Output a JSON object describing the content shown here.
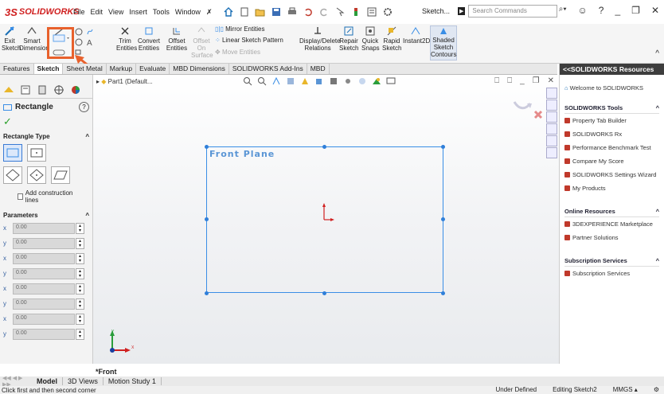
{
  "app": {
    "logo_text": "SOLIDWORKS",
    "logo_mark": "3S"
  },
  "menu": [
    "File",
    "Edit",
    "View",
    "Insert",
    "Tools",
    "Window"
  ],
  "title_doc": "Sketch...",
  "search": {
    "placeholder": "Search Commands"
  },
  "ribbon": {
    "exit_sketch": "Exit Sketch",
    "smart_dimension": "Smart Dimension",
    "trim_entities": "Trim Entities",
    "convert_entities": "Convert Entities",
    "offset_entities": "Offset Entities",
    "offset_on_surface": "Offset On Surface",
    "mirror_entities": "Mirror Entities",
    "linear_sketch_pattern": "Linear Sketch Pattern",
    "move_entities": "Move Entities",
    "display_delete_relations": "Display/Delete Relations",
    "repair_sketch": "Repair Sketch",
    "quick_snaps": "Quick Snaps",
    "rapid_sketch": "Rapid Sketch",
    "instant2d": "Instant2D",
    "shaded_sketch_contours": "Shaded Sketch Contours"
  },
  "tabs": [
    "Features",
    "Sketch",
    "Sheet Metal",
    "Markup",
    "Evaluate",
    "MBD Dimensions",
    "SOLIDWORKS Add-Ins",
    "MBD"
  ],
  "active_tab": "Sketch",
  "property_manager": {
    "title": "Rectangle",
    "help": "?",
    "rectangle_type_label": "Rectangle Type",
    "add_construction_lines": "Add construction lines",
    "parameters_label": "Parameters",
    "params": [
      {
        "axis": "x",
        "value": "0.00"
      },
      {
        "axis": "y",
        "value": "0.00"
      },
      {
        "axis": "x",
        "value": "0.00"
      },
      {
        "axis": "y",
        "value": "0.00"
      },
      {
        "axis": "x",
        "value": "0.00"
      },
      {
        "axis": "y",
        "value": "0.00"
      },
      {
        "axis": "x",
        "value": "0.00"
      },
      {
        "axis": "y",
        "value": "0.00"
      }
    ]
  },
  "graphics": {
    "tree_item": "Part1 (Default...",
    "plane_label": "Front Plane",
    "view_label": "*Front"
  },
  "resources_panel": {
    "title": "<<SOLIDWORKS Resources",
    "welcome": "Welcome to SOLIDWORKS",
    "sections": [
      {
        "title": "SOLIDWORKS Tools",
        "items": [
          "Property Tab Builder",
          "SOLIDWORKS Rx",
          "Performance Benchmark Test",
          "Compare My Score",
          "SOLIDWORKS Settings Wizard",
          "My Products"
        ]
      },
      {
        "title": "Online Resources",
        "items": [
          "3DEXPERIENCE Marketplace",
          "Partner Solutions"
        ]
      },
      {
        "title": "Subscription Services",
        "items": [
          "Subscription Services"
        ]
      }
    ]
  },
  "bottom_tabs": [
    "Model",
    "3D Views",
    "Motion Study 1"
  ],
  "active_bottom_tab": "Model",
  "status": {
    "prompt": "Click first and then second corner",
    "defined": "Under Defined",
    "editing": "Editing Sketch2",
    "units": "MMGS"
  },
  "colors": {
    "accent": "#e8612c",
    "sketch_blue": "#3a8ee6",
    "brand_red": "#d02020"
  }
}
